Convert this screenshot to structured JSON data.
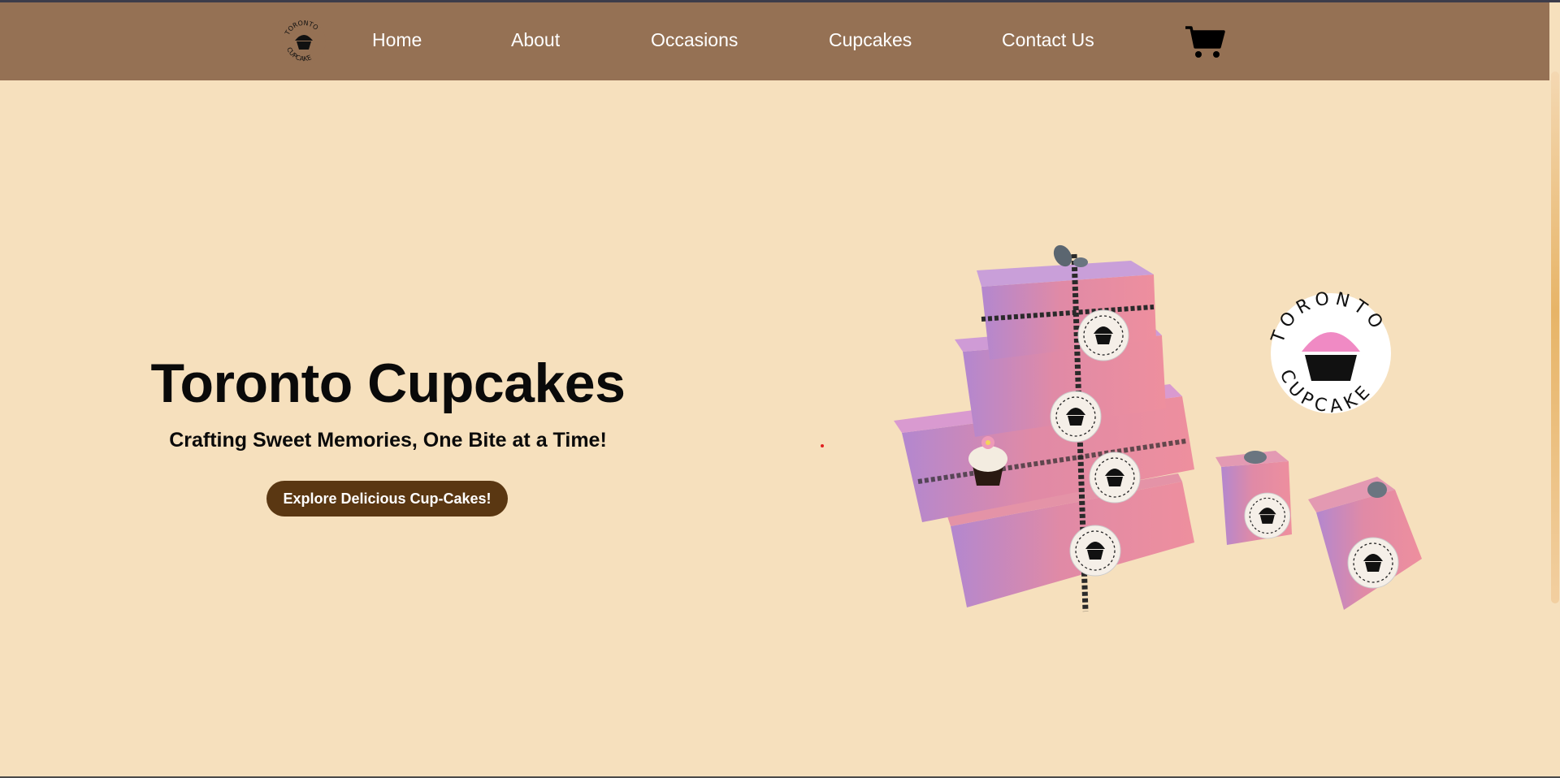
{
  "nav": {
    "logo_icon": "toronto-cupcake-logo",
    "links": [
      "Home",
      "About",
      "Occasions",
      "Cupcakes",
      "Contact Us"
    ],
    "cart_icon": "shopping-cart-icon"
  },
  "hero": {
    "title": "Toronto Cupcakes",
    "subtitle": "Crafting Sweet Memories, One Bite at a Time!",
    "cta_label": "Explore Delicious Cup-Cakes!"
  },
  "colors": {
    "navbar": "#957154",
    "page_background": "#f6e0bd",
    "cta_background": "#5a3712",
    "box_pink": "#e9869a",
    "box_lilac": "#b88ad0"
  }
}
